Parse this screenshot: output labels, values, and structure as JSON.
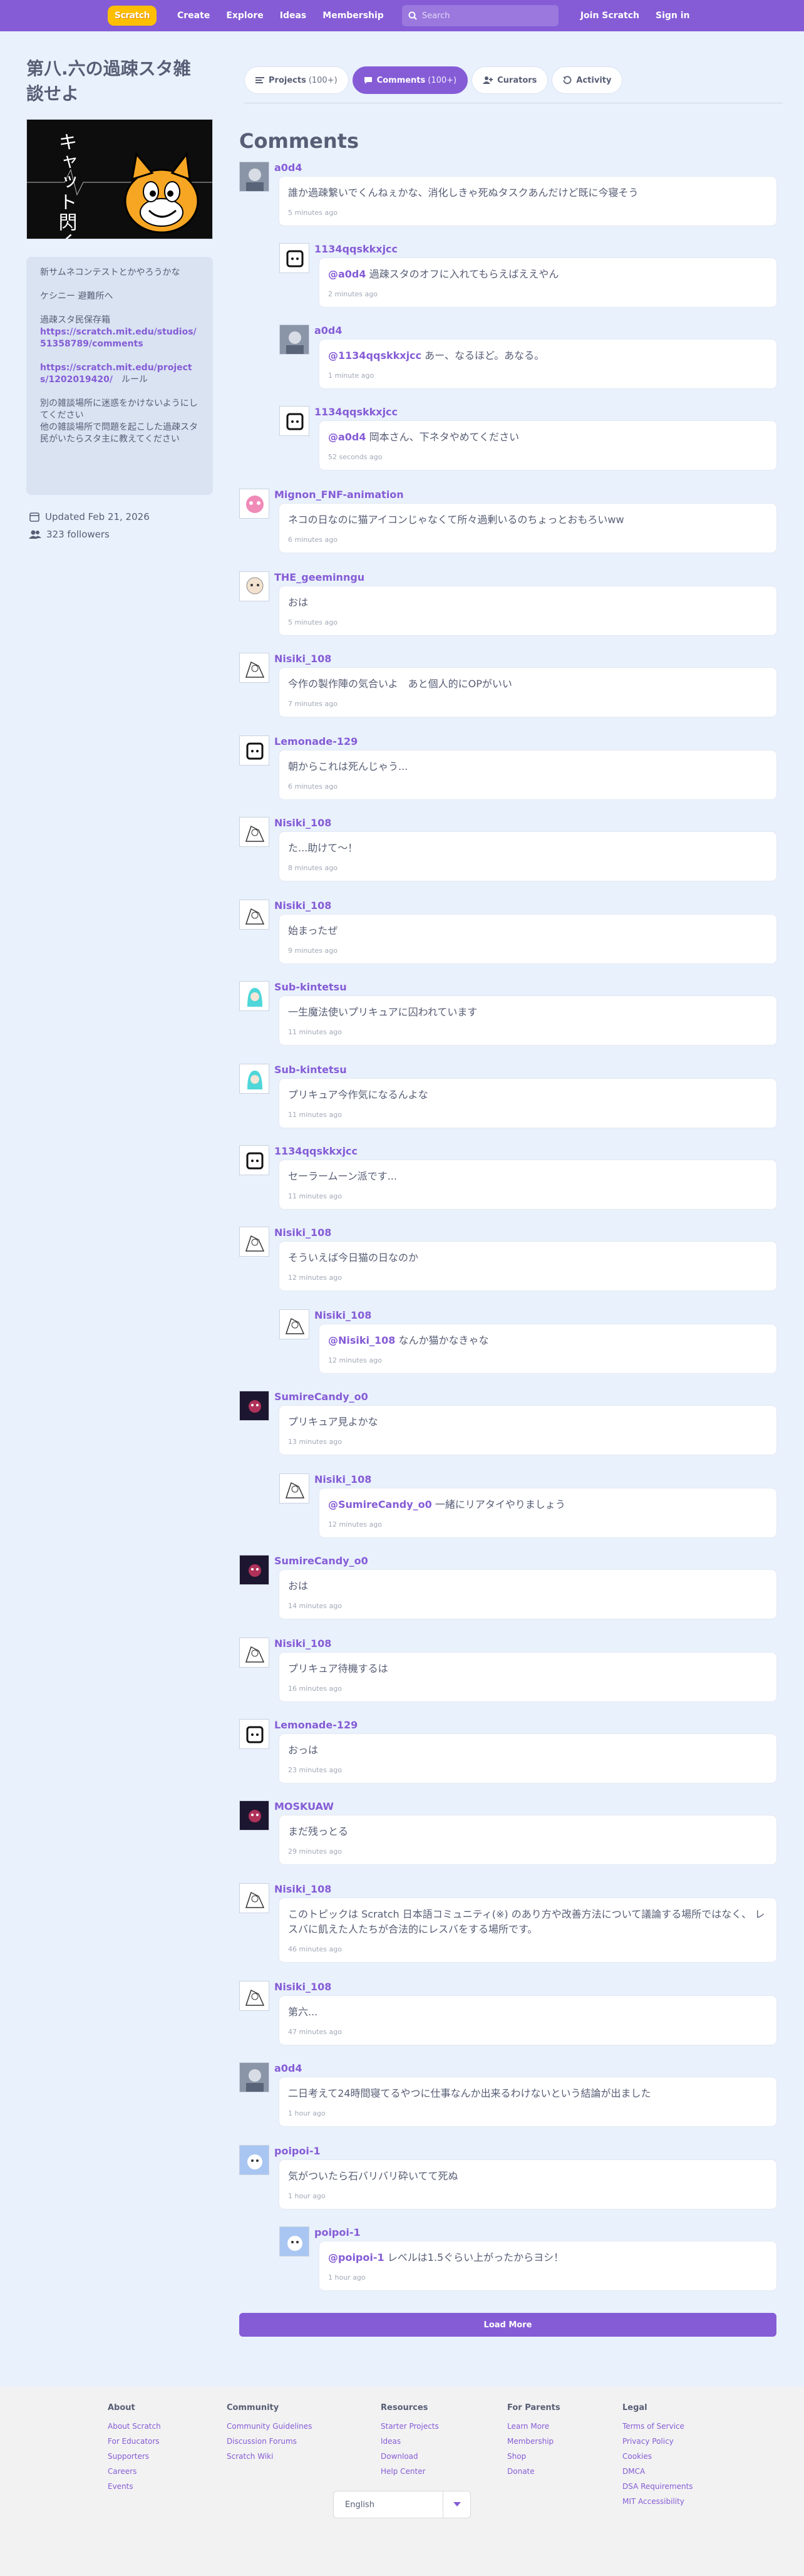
{
  "nav": {
    "logo": "Scratch",
    "links": [
      "Create",
      "Explore",
      "Ideas",
      "Membership"
    ],
    "search_placeholder": "Search",
    "join": "Join Scratch",
    "signin": "Sign in"
  },
  "studio": {
    "title": "第八.六の過疎スタ雑談せよ",
    "thumb_text": "キャット閃く",
    "description": [
      "新サムネコンテストとかやろうかな",
      "ケシニー 避難所へ",
      "過疎スタ民保存箱",
      "https://scratch.mit.edu/studios/51358789/comments",
      "https://scratch.mit.edu/projects/1202019420/",
      "ルール",
      "別の雑談場所に迷惑をかけないようにしてください",
      "他の雑談場所で問題を起こした過疎スタ民がいたらスタ主に教えてください"
    ],
    "updated": "Updated Feb 21, 2026",
    "followers": "323 followers"
  },
  "tabs": [
    {
      "label": "Projects",
      "count": "(100+)"
    },
    {
      "label": "Comments",
      "count": "(100+)"
    },
    {
      "label": "Curators",
      "count": ""
    },
    {
      "label": "Activity",
      "count": ""
    }
  ],
  "comments_heading": "Comments",
  "comments": [
    {
      "user": "a0d4",
      "mention": "",
      "text": "誰か過疎繋いでくんねぇかな、消化しきゃ死ぬタスクあんだけど既に今寝そう",
      "time": "5 minutes ago",
      "avatar": "photo"
    },
    {
      "user": "1134qqskkxjcc",
      "mention": "@a0d4",
      "text": "過疎スタのオフに入れてもらえばええやん",
      "time": "2 minutes ago",
      "avatar": "line"
    },
    {
      "user": "a0d4",
      "mention": "@1134qqskkxjcc",
      "text": "あー、なるほど。あなる。",
      "time": "1 minute ago",
      "avatar": "photo"
    },
    {
      "user": "1134qqskkxjcc",
      "mention": "@a0d4",
      "text": "岡本さん、下ネタやめてください",
      "time": "52 seconds ago",
      "avatar": "line"
    },
    {
      "user": "Mignon_FNF-animation",
      "mention": "",
      "text": "ネコの日なのに猫アイコンじゃなくて所々過剰いるのちょっとおもろいww",
      "time": "6 minutes ago",
      "avatar": "pink"
    },
    {
      "user": "THE_geeminngu",
      "mention": "",
      "text": "おは",
      "time": "5 minutes ago",
      "avatar": "face"
    },
    {
      "user": "Nisiki_108",
      "mention": "",
      "text": "今作の製作陣の気合いよ　あと個人的にOPがいい",
      "time": "7 minutes ago",
      "avatar": "sketch"
    },
    {
      "user": "Lemonade-129",
      "mention": "",
      "text": "朝からこれは死んじゃう...",
      "time": "6 minutes ago",
      "avatar": "line"
    },
    {
      "user": "Nisiki_108",
      "mention": "",
      "text": "た...助けて～！",
      "time": "8 minutes ago",
      "avatar": "sketch"
    },
    {
      "user": "Nisiki_108",
      "mention": "",
      "text": "始まったぜ",
      "time": "9 minutes ago",
      "avatar": "sketch"
    },
    {
      "user": "Sub-kintetsu",
      "mention": "",
      "text": "一生魔法使いプリキュアに囚われています",
      "time": "11 minutes ago",
      "avatar": "teal"
    },
    {
      "user": "Sub-kintetsu",
      "mention": "",
      "text": "プリキュア今作気になるんよな",
      "time": "11 minutes ago",
      "avatar": "teal"
    },
    {
      "user": "1134qqskkxjcc",
      "mention": "",
      "text": "セーラームーン派です...",
      "time": "11 minutes ago",
      "avatar": "line"
    },
    {
      "user": "Nisiki_108",
      "mention": "",
      "text": "そういえば今日猫の日なのか",
      "time": "12 minutes ago",
      "avatar": "sketch"
    },
    {
      "user": "Nisiki_108",
      "mention": "@Nisiki_108",
      "text": "なんか猫かなきゃな",
      "time": "12 minutes ago",
      "avatar": "sketch"
    },
    {
      "user": "SumireCandy_o0",
      "mention": "",
      "text": "プリキュア見よかな",
      "time": "13 minutes ago",
      "avatar": "dark"
    },
    {
      "user": "Nisiki_108",
      "mention": "@SumireCandy_o0",
      "text": "一緒にリアタイやりましょう",
      "time": "12 minutes ago",
      "avatar": "sketch"
    },
    {
      "user": "SumireCandy_o0",
      "mention": "",
      "text": "おは",
      "time": "14 minutes ago",
      "avatar": "dark"
    },
    {
      "user": "Nisiki_108",
      "mention": "",
      "text": "プリキュア待機するは",
      "time": "16 minutes ago",
      "avatar": "sketch"
    },
    {
      "user": "Lemonade-129",
      "mention": "",
      "text": "おっは",
      "time": "23 minutes ago",
      "avatar": "line"
    },
    {
      "user": "MOSKUAW",
      "mention": "",
      "text": "まだ残っとる",
      "time": "29 minutes ago",
      "avatar": "dark"
    },
    {
      "user": "Nisiki_108",
      "mention": "",
      "text": "このトピックは Scratch 日本語コミュニティ(※) のあり方や改善方法について議論する場所ではなく、 レスバに飢えた人たちが合法的にレスバをする場所です。",
      "time": "46 minutes ago",
      "avatar": "sketch"
    },
    {
      "user": "Nisiki_108",
      "mention": "",
      "text": "第六...",
      "time": "47 minutes ago",
      "avatar": "sketch"
    },
    {
      "user": "a0d4",
      "mention": "",
      "text": "二日考えて24時間寝てるやつに仕事なんか出来るわけないという結論が出ました",
      "time": "1 hour ago",
      "avatar": "photo"
    },
    {
      "user": "poipoi-1",
      "mention": "",
      "text": "気がついたら石バリバリ砕いてて死ぬ",
      "time": "1 hour ago",
      "avatar": "blue"
    },
    {
      "user": "poipoi-1",
      "mention": "@poipoi-1",
      "text": "レベルは1.5ぐらい上がったからヨシ！",
      "time": "1 hour ago",
      "avatar": "blue"
    }
  ],
  "load_more": "Load More",
  "footer": {
    "columns": [
      {
        "title": "About",
        "items": [
          "About Scratch",
          "For Educators",
          "Supporters",
          "Careers",
          "Events"
        ]
      },
      {
        "title": "Community",
        "items": [
          "Community Guidelines",
          "Discussion Forums",
          "Scratch Wiki"
        ]
      },
      {
        "title": "Resources",
        "items": [
          "Starter Projects",
          "Ideas",
          "Download",
          "Help Center"
        ]
      },
      {
        "title": "For Parents",
        "items": [
          "Learn More",
          "Membership",
          "Shop",
          "Donate"
        ]
      },
      {
        "title": "Legal",
        "items": [
          "Terms of Service",
          "Privacy Policy",
          "Cookies",
          "DMCA",
          "DSA Requirements",
          "MIT Accessibility"
        ]
      }
    ],
    "language": "English"
  },
  "colors": {
    "accent": "#855cd6",
    "background": "#e9f1fc",
    "text": "#575e75"
  }
}
